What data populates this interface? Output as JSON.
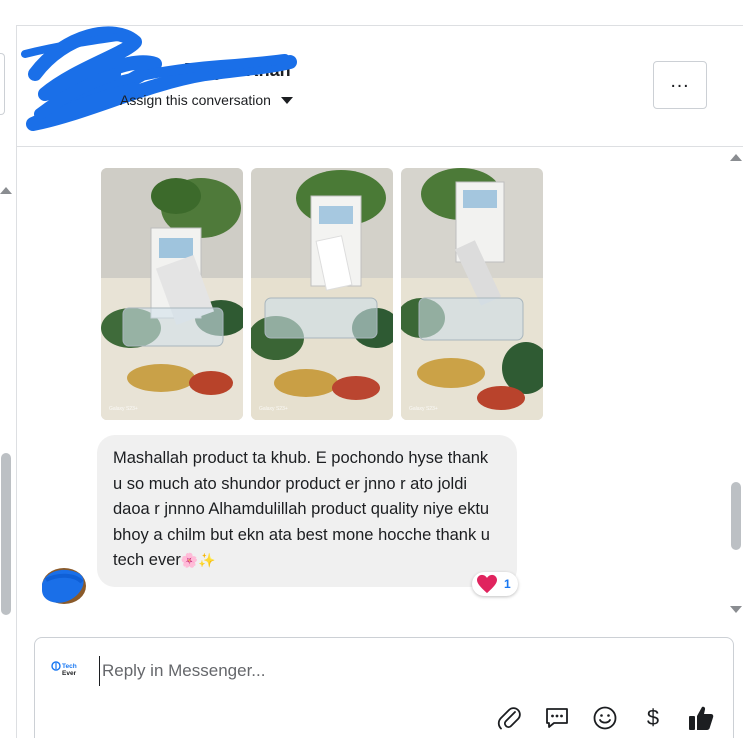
{
  "header": {
    "contact_name": "Tanjila Khan",
    "assign_label": "Assign this conversation",
    "more_label": "…"
  },
  "conversation": {
    "photos": [
      {
        "watermark": "Galaxy S23+"
      },
      {
        "watermark": "Galaxy S23+"
      },
      {
        "watermark": "Galaxy S23+"
      }
    ],
    "message_text": "Mashallah product ta khub. E pochondo hyse thank u so much ato shundor product er jnno r ato joldi daoa r jnnno Alhamdulillah product quality niye ektu bhoy a chilm but ekn ata best mone hocche thank u tech ever",
    "message_emoji": "🌸✨",
    "reaction": {
      "icon": "heart-icon",
      "count": "1"
    }
  },
  "composer": {
    "placeholder": "Reply in Messenger...",
    "page_logo_text": "Tech Ever",
    "tools": [
      "attach-icon",
      "saved-reply-icon",
      "emoji-icon",
      "payment-icon",
      "like-icon"
    ]
  },
  "colors": {
    "accent": "#1877f2",
    "bubble": "#f0f0f0",
    "redaction": "#1a6fe8",
    "reaction_heart": "#e0245e"
  }
}
